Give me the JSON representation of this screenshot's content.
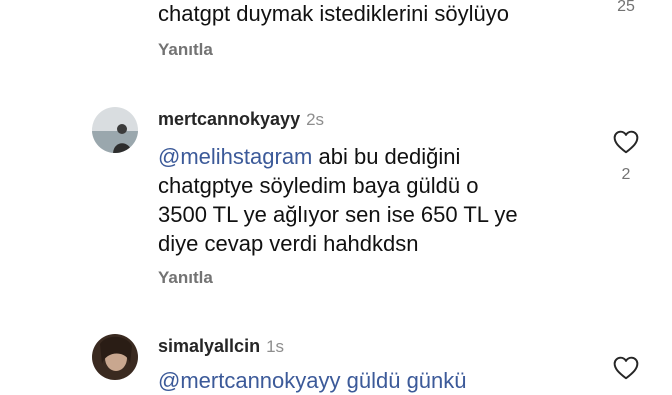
{
  "comments": [
    {
      "text_line": "chatgpt duymak istediklerini söylüyo",
      "reply_label": "Yanıtla",
      "likes": "25"
    },
    {
      "username": "mertcannokyayy",
      "time": "2s",
      "mention": "@melihstagram",
      "text_first": " abi bu dediğini",
      "text_lines": [
        "chatgptye söyledim baya güldü o",
        "3500 TL ye ağlıyor sen ise 650 TL ye",
        "diye cevap verdi hahdkdsn"
      ],
      "reply_label": "Yanıtla",
      "likes": "2"
    },
    {
      "username": "simalyallcin",
      "time": "1s",
      "partial_text": "@mertcannokyayy güldü günkü"
    }
  ],
  "icons": {
    "like": "heart-icon",
    "avatar": "profile-photo"
  }
}
